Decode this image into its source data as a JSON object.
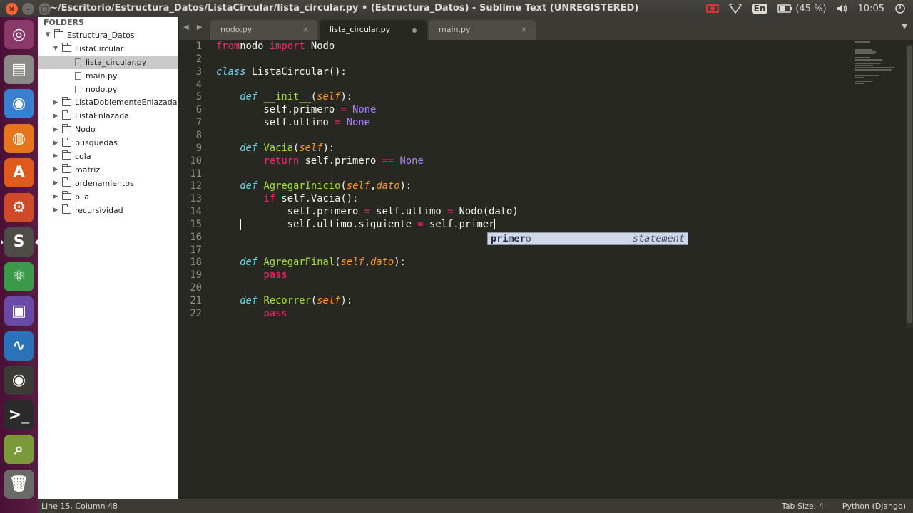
{
  "window": {
    "title": "~/Escritorio/Estructura_Datos/ListaCircular/lista_circular.py • (Estructura_Datos) - Sublime Text (UNREGISTERED)",
    "close_glyph": "×",
    "minimize_glyph": "–",
    "maximize_glyph": "□"
  },
  "indicators": {
    "keyboard_lang": "En",
    "battery": "(45 %)",
    "clock": "10:05"
  },
  "sidebar": {
    "header": "FOLDERS",
    "items": [
      {
        "label": "Estructura_Datos",
        "depth": 0,
        "kind": "folder",
        "expanded": true
      },
      {
        "label": "ListaCircular",
        "depth": 1,
        "kind": "folder",
        "expanded": true
      },
      {
        "label": "lista_circular.py",
        "depth": 2,
        "kind": "file",
        "selected": true
      },
      {
        "label": "main.py",
        "depth": 2,
        "kind": "file"
      },
      {
        "label": "nodo.py",
        "depth": 2,
        "kind": "file"
      },
      {
        "label": "ListaDoblementeEnlazada",
        "depth": 1,
        "kind": "folder"
      },
      {
        "label": "ListaEnlazada",
        "depth": 1,
        "kind": "folder"
      },
      {
        "label": "Nodo",
        "depth": 1,
        "kind": "folder"
      },
      {
        "label": "busquedas",
        "depth": 1,
        "kind": "folder"
      },
      {
        "label": "cola",
        "depth": 1,
        "kind": "folder"
      },
      {
        "label": "matriz",
        "depth": 1,
        "kind": "folder"
      },
      {
        "label": "ordenamientos",
        "depth": 1,
        "kind": "folder"
      },
      {
        "label": "pila",
        "depth": 1,
        "kind": "folder"
      },
      {
        "label": "recursividad",
        "depth": 1,
        "kind": "folder"
      }
    ]
  },
  "tabs": [
    {
      "label": "nodo.py",
      "active": false,
      "dirty": false
    },
    {
      "label": "lista_circular.py",
      "active": true,
      "dirty": true
    },
    {
      "label": "main.py",
      "active": false,
      "dirty": false
    }
  ],
  "tab_close_glyph": "×",
  "tab_nav": "◀ ▶",
  "tab_menu": "▼",
  "editor": {
    "lines": [
      {
        "n": "1",
        "tokens": [
          [
            "kw",
            "from"
          ],
          [
            "",
            "nodo "
          ],
          [
            "kw",
            "import"
          ],
          [
            "",
            " Nodo"
          ]
        ]
      },
      {
        "n": "2",
        "tokens": []
      },
      {
        "n": "3",
        "tokens": [
          [
            "st",
            "class"
          ],
          [
            "",
            " ListaCircular():"
          ]
        ]
      },
      {
        "n": "4",
        "tokens": []
      },
      {
        "n": "5",
        "tokens": [
          [
            "",
            "    "
          ],
          [
            "st",
            "def"
          ],
          [
            "",
            " "
          ],
          [
            "fn",
            "__init__"
          ],
          [
            "",
            "("
          ],
          [
            "prm",
            "self"
          ],
          [
            "",
            "):"
          ]
        ]
      },
      {
        "n": "6",
        "tokens": [
          [
            "",
            "        self.primero "
          ],
          [
            "kw",
            "="
          ],
          [
            "",
            " "
          ],
          [
            "cn",
            "None"
          ]
        ]
      },
      {
        "n": "7",
        "tokens": [
          [
            "",
            "        self.ultimo "
          ],
          [
            "kw",
            "="
          ],
          [
            "",
            " "
          ],
          [
            "cn",
            "None"
          ]
        ]
      },
      {
        "n": "8",
        "tokens": []
      },
      {
        "n": "9",
        "tokens": [
          [
            "",
            "    "
          ],
          [
            "st",
            "def"
          ],
          [
            "",
            " "
          ],
          [
            "fn",
            "Vacia"
          ],
          [
            "",
            "("
          ],
          [
            "prm",
            "self"
          ],
          [
            "",
            "):"
          ]
        ]
      },
      {
        "n": "10",
        "tokens": [
          [
            "",
            "        "
          ],
          [
            "kw",
            "return"
          ],
          [
            "",
            " self.primero "
          ],
          [
            "kw",
            "=="
          ],
          [
            "",
            " "
          ],
          [
            "cn",
            "None"
          ]
        ]
      },
      {
        "n": "11",
        "tokens": []
      },
      {
        "n": "12",
        "tokens": [
          [
            "",
            "    "
          ],
          [
            "st",
            "def"
          ],
          [
            "",
            " "
          ],
          [
            "fn",
            "AgregarInicio"
          ],
          [
            "",
            "("
          ],
          [
            "prm",
            "self"
          ],
          [
            "",
            ","
          ],
          [
            "prm",
            "dato"
          ],
          [
            "",
            "):"
          ]
        ]
      },
      {
        "n": "13",
        "tokens": [
          [
            "",
            "        "
          ],
          [
            "kw",
            "if"
          ],
          [
            "",
            " self.Vacia():"
          ]
        ]
      },
      {
        "n": "14",
        "tokens": [
          [
            "",
            "            self.primero "
          ],
          [
            "kw",
            "="
          ],
          [
            "",
            " self.ultimo "
          ],
          [
            "kw",
            "="
          ],
          [
            "",
            " Nodo(dato)"
          ]
        ]
      },
      {
        "n": "15",
        "tokens": [
          [
            "",
            "            self.ultimo.siguiente "
          ],
          [
            "kw",
            "="
          ],
          [
            "",
            " self.primer"
          ]
        ],
        "cursor": true
      },
      {
        "n": "16",
        "tokens": []
      },
      {
        "n": "17",
        "tokens": []
      },
      {
        "n": "18",
        "tokens": [
          [
            "",
            "    "
          ],
          [
            "st",
            "def"
          ],
          [
            "",
            " "
          ],
          [
            "fn",
            "AgregarFinal"
          ],
          [
            "",
            "("
          ],
          [
            "prm",
            "self"
          ],
          [
            "",
            ","
          ],
          [
            "prm",
            "dato"
          ],
          [
            "",
            "):"
          ]
        ]
      },
      {
        "n": "19",
        "tokens": [
          [
            "",
            "        "
          ],
          [
            "kw",
            "pass"
          ]
        ]
      },
      {
        "n": "20",
        "tokens": []
      },
      {
        "n": "21",
        "tokens": [
          [
            "",
            "    "
          ],
          [
            "st",
            "def"
          ],
          [
            "",
            " "
          ],
          [
            "fn",
            "Recorrer"
          ],
          [
            "",
            "("
          ],
          [
            "prm",
            "self"
          ],
          [
            "",
            "):"
          ]
        ]
      },
      {
        "n": "22",
        "tokens": [
          [
            "",
            "        "
          ],
          [
            "kw",
            "pass"
          ]
        ]
      }
    ],
    "autocomplete": {
      "match": "primer",
      "rest": "o",
      "hint": "statement"
    }
  },
  "status": {
    "position": "Line 15, Column 48",
    "tab_size": "Tab Size: 4",
    "syntax": "Python (Django)"
  },
  "launcher": [
    {
      "name": "ubuntu-dash-icon",
      "glyph": "◎",
      "color": "#8a3a6a"
    },
    {
      "name": "files-icon",
      "glyph": "▤",
      "color": "#8c8a86"
    },
    {
      "name": "chromium-icon",
      "glyph": "◉",
      "color": "#3b7fd1"
    },
    {
      "name": "firefox-icon",
      "glyph": "◍",
      "color": "#e8741c"
    },
    {
      "name": "software-center-icon",
      "glyph": "A",
      "color": "#e05a1e"
    },
    {
      "name": "system-settings-icon",
      "glyph": "⚙",
      "color": "#cf4a2a"
    },
    {
      "name": "sublime-text-icon",
      "glyph": "S",
      "color": "#4d4c47",
      "active": true
    },
    {
      "name": "atom-app-icon",
      "glyph": "⚛",
      "color": "#3a9a4a"
    },
    {
      "name": "media-player-icon",
      "glyph": "▣",
      "color": "#6a4aa8"
    },
    {
      "name": "system-monitor-icon",
      "glyph": "∿",
      "color": "#2a73b8"
    },
    {
      "name": "webcam-icon",
      "glyph": "◉",
      "color": "#3b3a35"
    },
    {
      "name": "terminal-icon",
      "glyph": ">_",
      "color": "#2b2b2b"
    },
    {
      "name": "screenshot-icon",
      "glyph": "⌕",
      "color": "#7a9a3a"
    },
    {
      "name": "trash-icon",
      "glyph": "🗑",
      "color": "#6a6a66"
    }
  ],
  "colors": {
    "editor_bg": "#272822",
    "keyword": "#f92672",
    "storage": "#66d9ef",
    "function": "#a6e22e",
    "parameter": "#fd971f",
    "constant": "#ae81ff"
  }
}
